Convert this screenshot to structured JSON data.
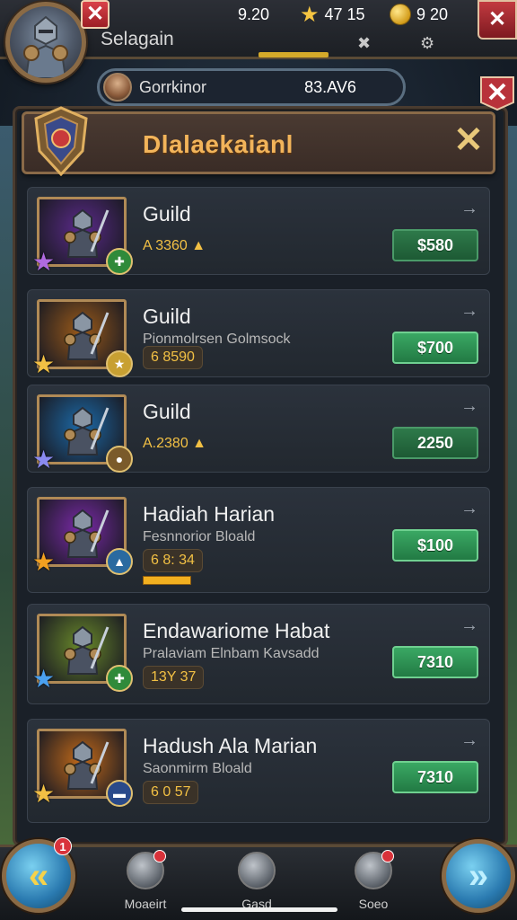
{
  "topbar": {
    "username": "Selagain",
    "stats": [
      {
        "icon": "none",
        "value": "9.20"
      },
      {
        "icon": "star-icon",
        "value": "47 15"
      },
      {
        "icon": "coin-icon",
        "value": "9   20"
      }
    ],
    "mini_icons": [
      "✖",
      "⚙"
    ],
    "close_glyph": "✕"
  },
  "searchbar": {
    "name": "Gorrkinor",
    "value": "83.AV6"
  },
  "header": {
    "title": "Dlalaekaianl",
    "close_glyph": "✕"
  },
  "cards": [
    {
      "title": "Guild",
      "subtitle": "",
      "stat": "A 3360 ▲",
      "price": "$580",
      "arrow": "→",
      "theme": "#5b2a8a",
      "star_color": "#b06ae0",
      "badge_color": "#2f8a3a",
      "badge": "✚"
    },
    {
      "title": "Guild",
      "subtitle": "Pionmolrsen Golmsock",
      "stat": "6 8590",
      "price": "$700",
      "arrow": "→",
      "theme": "#9a5a1a",
      "star_color": "#f2c044",
      "badge_color": "#c8a032",
      "badge": "★"
    },
    {
      "title": "Guild",
      "subtitle": "",
      "stat": "A.2380 ▲",
      "price": "2250",
      "arrow": "→",
      "theme": "#1c6aa8",
      "star_color": "#8a8af0",
      "badge_color": "#7a5a2a",
      "badge": "●"
    },
    {
      "title": "Hadiah Harian",
      "subtitle": "Fesnnorior Bloald",
      "stat": "6 8: 34",
      "price": "$100",
      "arrow": "→",
      "theme": "#7a2aa8",
      "star_color": "#f2a020",
      "badge_color": "#2a6aa0",
      "badge": "▲"
    },
    {
      "title": "Endawariome Habat",
      "subtitle": "Pralaviam Elnbam Kavsadd",
      "stat": "13Y 37",
      "price": "7310",
      "arrow": "→",
      "theme": "#6a8a2a",
      "star_color": "#4aa0f0",
      "badge_color": "#2f8a3a",
      "badge": "✚"
    },
    {
      "title": "Hadush Ala Marian",
      "subtitle": "Saonmirm Bloald",
      "stat": "6 0 57",
      "price": "7310",
      "arrow": "→",
      "theme": "#c26a1a",
      "star_color": "#f2c044",
      "badge_color": "#2a4a8a",
      "badge": "▬"
    }
  ],
  "bottom_nav": {
    "left_notif": "1",
    "left_glyph": "«",
    "right_glyph": "»",
    "items": [
      {
        "label": "Moaeirt"
      },
      {
        "label": "Gasd"
      },
      {
        "label": "Soeo"
      }
    ]
  }
}
